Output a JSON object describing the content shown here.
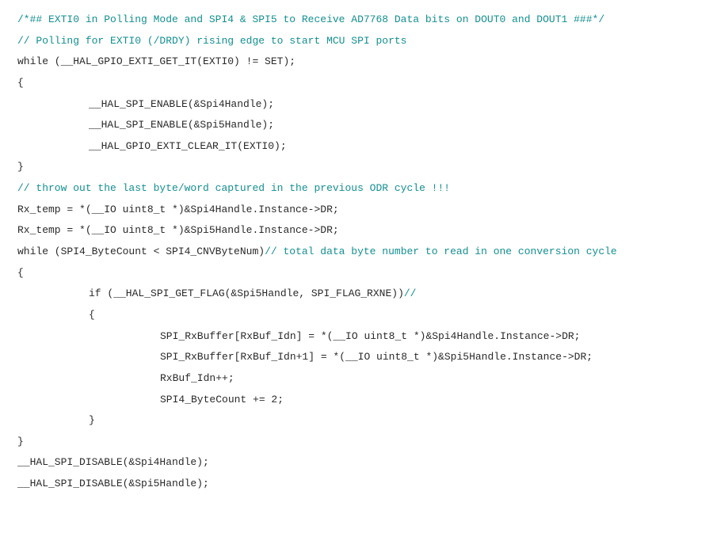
{
  "lines": {
    "l1_a": "/*## EXTI0 in Polling Mode and SPI4 & SPI5 to Receive AD7768 Data bits on DOUT0 and DOUT1 ###*/",
    "l2_a": "// Polling for EXTI0 (/DRDY) rising edge to start MCU SPI ports",
    "l3": "while (__HAL_GPIO_EXTI_GET_IT(EXTI0) != SET);",
    "l4": "{",
    "l5": "__HAL_SPI_ENABLE(&Spi4Handle);",
    "l6": "__HAL_SPI_ENABLE(&Spi5Handle);",
    "l7": "__HAL_GPIO_EXTI_CLEAR_IT(EXTI0);",
    "l8": "}",
    "l9_a": "// throw out the last byte/word captured in the previous ODR cycle !!!",
    "l10": "Rx_temp = *(__IO uint8_t *)&Spi4Handle.Instance->DR;",
    "l11": "Rx_temp = *(__IO uint8_t *)&Spi5Handle.Instance->DR;",
    "l12a": "while (SPI4_ByteCount < SPI4_CNVByteNum)",
    "l12b": "// total data byte number to read in one conversion cycle",
    "l13": "{",
    "l14a": "if (__HAL_SPI_GET_FLAG(&Spi5Handle, SPI_FLAG_RXNE))",
    "l14b": "//",
    "l15": "{",
    "l16": "SPI_RxBuffer[RxBuf_Idn] = *(__IO uint8_t *)&Spi4Handle.Instance->DR;",
    "l17": "SPI_RxBuffer[RxBuf_Idn+1] = *(__IO uint8_t *)&Spi5Handle.Instance->DR;",
    "l18": "RxBuf_Idn++;",
    "l19": "SPI4_ByteCount += 2;",
    "l20": "}",
    "l21": "}",
    "l22": "__HAL_SPI_DISABLE(&Spi4Handle);",
    "l23": "__HAL_SPI_DISABLE(&Spi5Handle);"
  }
}
